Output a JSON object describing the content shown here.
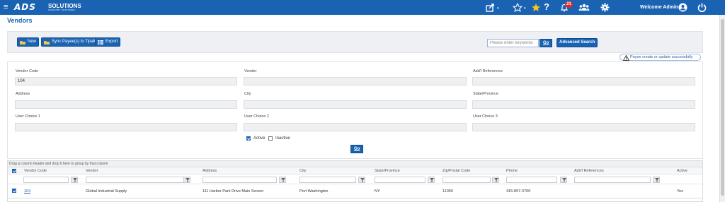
{
  "header": {
    "logo_mark": "ADS",
    "logo_text": "SOLUTIONS",
    "logo_tagline": "INDUSTRY SOFTWARE",
    "notification_count": "21",
    "help_label": "?",
    "welcome_text": "Welcome Admin",
    "menu_glyph": "≡",
    "caret_glyph": "▾",
    "colors": {
      "bar": "#1a63b3",
      "star": "#f5c518",
      "badge": "#e02a2a"
    }
  },
  "page": {
    "title": "Vendors"
  },
  "toolbar": {
    "new_label": "New",
    "sync_label": "Sync Payee(s) to Tipalti",
    "export_label": "Export",
    "search_placeholder": "Please enter keywords",
    "search_go_label": "Go",
    "advanced_search_label": "Advanced Search"
  },
  "notice": {
    "icon": "warning-icon",
    "text": "Payee create or update successfully"
  },
  "filters": {
    "vendor_code": {
      "label": "Vendor Code",
      "value": "104"
    },
    "vendor": {
      "label": "Vendor",
      "value": ""
    },
    "addl_references": {
      "label": "Add'l References",
      "value": ""
    },
    "address": {
      "label": "Address",
      "value": ""
    },
    "city": {
      "label": "City",
      "value": ""
    },
    "state_province": {
      "label": "State/Province",
      "value": ""
    },
    "user_choice_1": {
      "label": "User Choice 1",
      "value": ""
    },
    "user_choice_2": {
      "label": "User Choice 2",
      "value": ""
    },
    "user_choice_3": {
      "label": "User Choice 3",
      "value": ""
    },
    "active": {
      "label": "Active",
      "checked": true
    },
    "inactive": {
      "label": "Inactive",
      "checked": false
    },
    "go_label": "Go"
  },
  "grid": {
    "group_hint": "Drag a column header and drop it here to group by that column",
    "columns": [
      "Vendor Code",
      "Vendor",
      "Address",
      "City",
      "State/Province",
      "Zip/Postal Code",
      "Phone",
      "Add'l References",
      "Active"
    ],
    "rows": [
      {
        "checked": true,
        "vendor_code": "104",
        "vendor": "Global Industrial Supply",
        "address": "111 Harbor Park Drive Main Screen",
        "city": "Port Washington",
        "state_province": "NY",
        "zip": "11050",
        "phone": "415-897-3700",
        "addl_references": "",
        "active": "Yes"
      }
    ]
  }
}
